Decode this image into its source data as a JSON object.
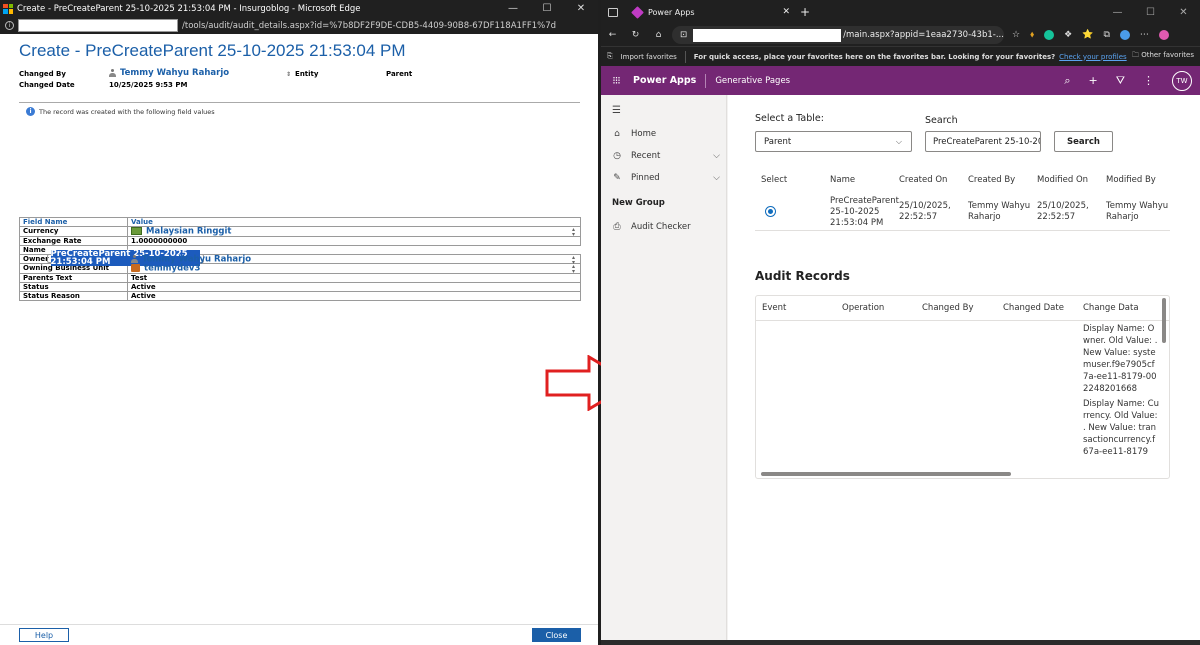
{
  "left_window": {
    "title": "Create - PreCreateParent 25-10-2025 21:53:04 PM - Insurgoblog - Microsoft Edge",
    "url_suffix": "/tools/audit/audit_details.aspx?id=%7b8DF2F9DE-CDB5-4409-90B8-67DF118A1FF1%7d",
    "heading": "Create - PreCreateParent 25-10-2025 21:53:04 PM",
    "changed_by_label": "Changed By",
    "changed_by_value": "Temmy Wahyu Raharjo",
    "entity_label": "Entity",
    "entity_value": "Parent",
    "changed_date_label": "Changed Date",
    "changed_date_value": "10/25/2025 9:53 PM",
    "note": "The record was created with the following field values",
    "col_field": "Field Name",
    "col_value": "Value",
    "rows": [
      {
        "field": "Currency",
        "value": "Malaysian Ringgit"
      },
      {
        "field": "Exchange Rate",
        "value": "1.0000000000"
      },
      {
        "field": "Name",
        "value": "PreCreateParent 25-10-2025 21:53:04 PM"
      },
      {
        "field": "Owner",
        "value": "Temmy Wahyu Raharjo"
      },
      {
        "field": "Owning Business Unit",
        "value": "temmydev3"
      },
      {
        "field": "Parents Text",
        "value": "Test"
      },
      {
        "field": "Status",
        "value": "Active"
      },
      {
        "field": "Status Reason",
        "value": "Active"
      }
    ],
    "help_label": "Help",
    "close_label": "Close"
  },
  "right_window": {
    "tab_title": "Power Apps",
    "url_suffix": "/main.aspx?appid=1eaa2730-43b1-...",
    "fav_import": "Import favorites",
    "fav_message": "For quick access, place your favorites here on the favorites bar. Looking for your favorites?",
    "fav_link": "Check your profiles",
    "fav_other": "Other favorites",
    "app_name": "Power Apps",
    "app_sub": "Generative Pages",
    "avatar": "TW",
    "nav": {
      "home": "Home",
      "recent": "Recent",
      "pinned": "Pinned",
      "group": "New Group",
      "audit_checker": "Audit Checker"
    },
    "select_table_label": "Select a Table:",
    "select_value": "Parent",
    "search_label": "Search",
    "search_value": "PreCreateParent 25-10-20",
    "search_button": "Search",
    "grid_headers": [
      "Select",
      "Name",
      "Created On",
      "Created By",
      "Modified On",
      "Modified By"
    ],
    "grid_row": {
      "name": "PreCreateParent 25-10-2025 21:53:04 PM",
      "created_on": "25/10/2025, 22:52:57",
      "created_by": "Temmy Wahyu Raharjo",
      "modified_on": "25/10/2025, 22:52:57",
      "modified_by": "Temmy Wahyu Raharjo"
    },
    "audit_title": "Audit Records",
    "audit_headers": [
      "Event",
      "Operation",
      "Changed By",
      "Changed Date",
      "Change Data"
    ],
    "change_data": [
      "Display Name: Owner. Old Value: . New Value: systemuser.f9e7905cf7a-ee11-8179-002248201668",
      "Display Name: Currency. Old Value: . New Value: transactioncurrency.f67a-ee11-8179"
    ]
  },
  "colors": {
    "powerapps_purple": "#742774",
    "link_blue": "#1b5fa8",
    "arrow_red": "#e02020"
  }
}
